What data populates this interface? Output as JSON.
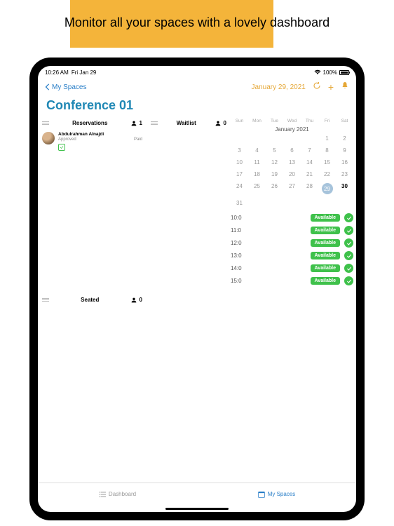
{
  "marketing": {
    "headline": "Monitor all your spaces with a lovely dashboard"
  },
  "status": {
    "time": "10:26 AM",
    "date": "Fri Jan 29",
    "battery": "100%"
  },
  "nav": {
    "back_label": "My Spaces",
    "date_label": "January 29, 2021"
  },
  "page_title": "Conference 01",
  "sections": {
    "reservations": {
      "label": "Reservations",
      "count": "1"
    },
    "waitlist": {
      "label": "Waitlist",
      "count": "0"
    },
    "seated": {
      "label": "Seated",
      "count": "0"
    }
  },
  "reservation_item": {
    "name": "Abdulrahman Alnajdi",
    "status": "Approved",
    "payment": "Paid"
  },
  "calendar": {
    "month_label": "January 2021",
    "dow": [
      "Sun",
      "Mon",
      "Tue",
      "Wed",
      "Thu",
      "Fri",
      "Sat"
    ],
    "weeks": [
      [
        "",
        "",
        "",
        "",
        "",
        "1",
        "2"
      ],
      [
        "3",
        "4",
        "5",
        "6",
        "7",
        "8",
        "9"
      ],
      [
        "10",
        "11",
        "12",
        "13",
        "14",
        "15",
        "16"
      ],
      [
        "17",
        "18",
        "19",
        "20",
        "21",
        "22",
        "23"
      ],
      [
        "24",
        "25",
        "26",
        "27",
        "28",
        "29",
        "30"
      ],
      [
        "31",
        "",
        "",
        "",
        "",
        "",
        ""
      ]
    ],
    "selected": "29",
    "bold": [
      "30"
    ]
  },
  "slots": [
    {
      "time": "10:0",
      "status": "Available"
    },
    {
      "time": "11:0",
      "status": "Available"
    },
    {
      "time": "12:0",
      "status": "Available"
    },
    {
      "time": "13:0",
      "status": "Available"
    },
    {
      "time": "14:0",
      "status": "Available"
    },
    {
      "time": "15:0",
      "status": "Available"
    }
  ],
  "tabbar": {
    "dashboard": "Dashboard",
    "my_spaces": "My Spaces"
  }
}
